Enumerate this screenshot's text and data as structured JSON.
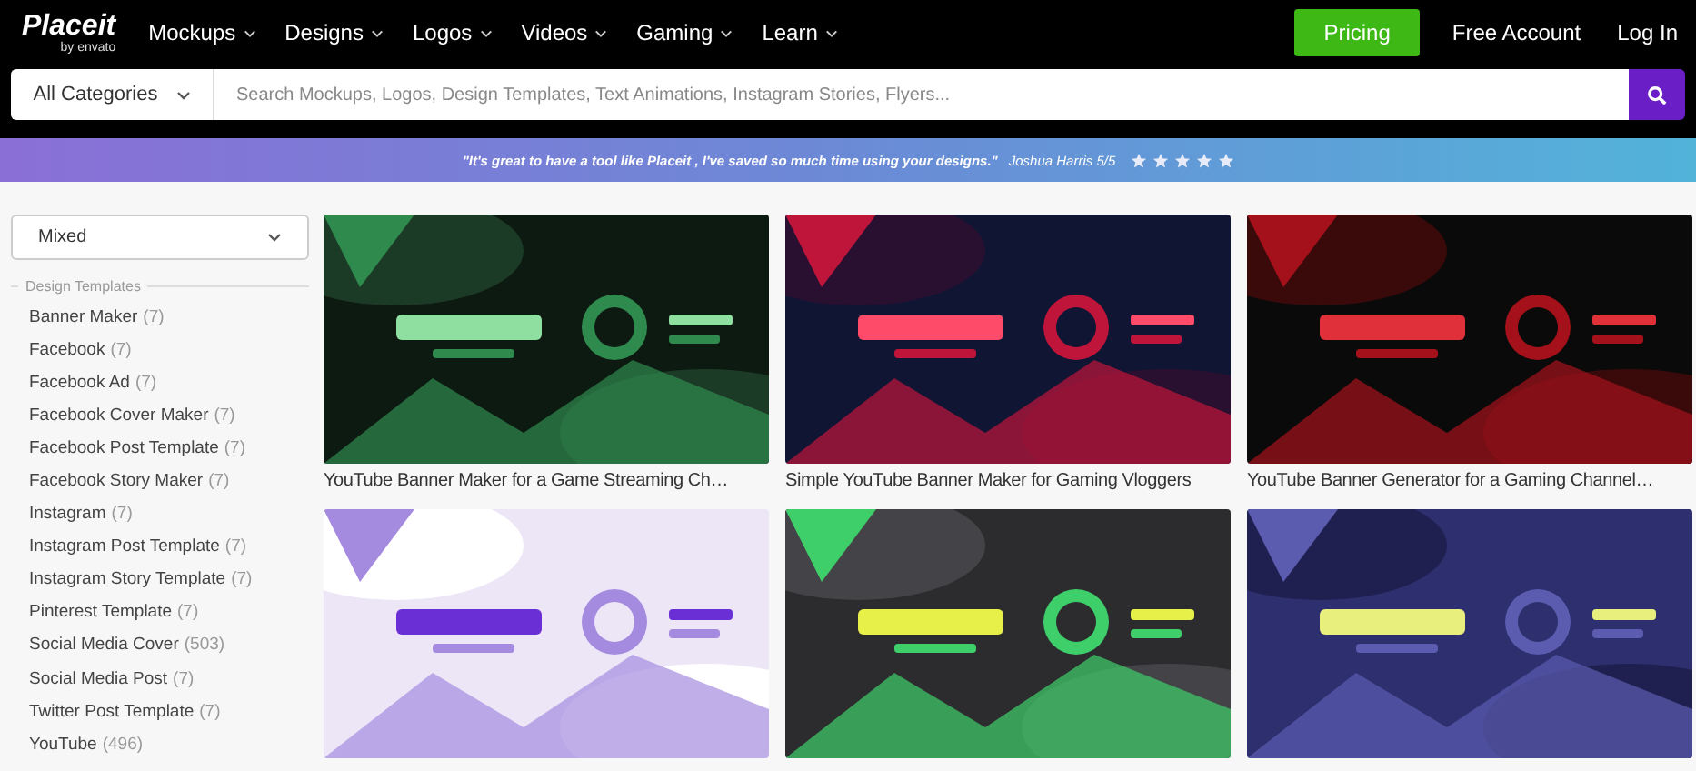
{
  "header": {
    "logo": "Placeit",
    "logo_sub": "by envato",
    "nav": [
      {
        "label": "Mockups"
      },
      {
        "label": "Designs"
      },
      {
        "label": "Logos"
      },
      {
        "label": "Videos"
      },
      {
        "label": "Gaming"
      },
      {
        "label": "Learn"
      }
    ],
    "pricing": "Pricing",
    "free_account": "Free Account",
    "login": "Log In"
  },
  "search": {
    "category": "All Categories",
    "placeholder": "Search Mockups, Logos, Design Templates, Text Animations, Instagram Stories, Flyers..."
  },
  "testimonial": {
    "quote": "\"It's great to have a tool like Placeit , I've saved so much time using your designs.\"",
    "author": "Joshua Harris 5/5",
    "stars": 5
  },
  "sidebar": {
    "sort": "Mixed",
    "heading": "Design Templates",
    "items": [
      {
        "name": "Banner Maker",
        "count": "(7)"
      },
      {
        "name": "Facebook",
        "count": "(7)"
      },
      {
        "name": "Facebook Ad",
        "count": "(7)"
      },
      {
        "name": "Facebook Cover Maker",
        "count": "(7)"
      },
      {
        "name": "Facebook Post Template",
        "count": "(7)"
      },
      {
        "name": "Facebook Story Maker",
        "count": "(7)"
      },
      {
        "name": "Instagram",
        "count": "(7)"
      },
      {
        "name": "Instagram Post Template",
        "count": "(7)"
      },
      {
        "name": "Instagram Story Template",
        "count": "(7)"
      },
      {
        "name": "Pinterest Template",
        "count": "(7)"
      },
      {
        "name": "Social Media Cover",
        "count": "(503)"
      },
      {
        "name": "Social Media Post",
        "count": "(7)"
      },
      {
        "name": "Twitter Post Template",
        "count": "(7)"
      },
      {
        "name": "YouTube",
        "count": "(496)"
      }
    ]
  },
  "cards": [
    {
      "kind": "picture",
      "title": "YouTube Banner Maker for a Game Streaming Ch…"
    },
    {
      "kind": "picture",
      "title": "Simple YouTube Banner Maker for Gaming Vloggers"
    },
    {
      "kind": "picture",
      "title": "YouTube Banner Generator for a Gaming Channel…"
    },
    {
      "kind": "picture"
    },
    {
      "kind": "picture"
    },
    {
      "kind": "picture"
    }
  ]
}
